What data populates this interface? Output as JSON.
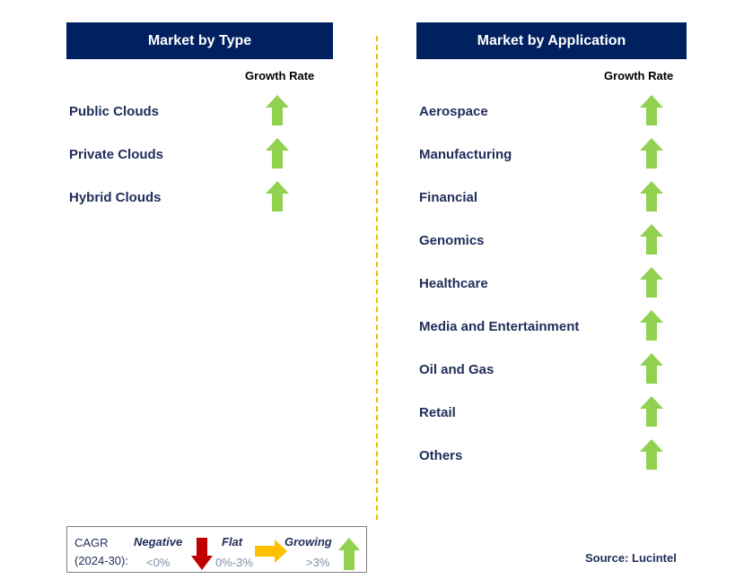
{
  "left": {
    "title": "Market by Type",
    "growth_label": "Growth Rate",
    "items": [
      {
        "label": "Public Clouds",
        "trend": "growing"
      },
      {
        "label": "Private Clouds",
        "trend": "growing"
      },
      {
        "label": "Hybrid Clouds",
        "trend": "growing"
      }
    ]
  },
  "right": {
    "title": "Market by Application",
    "growth_label": "Growth Rate",
    "items": [
      {
        "label": "Aerospace",
        "trend": "growing"
      },
      {
        "label": "Manufacturing",
        "trend": "growing"
      },
      {
        "label": "Financial",
        "trend": "growing"
      },
      {
        "label": "Genomics",
        "trend": "growing"
      },
      {
        "label": "Healthcare",
        "trend": "growing"
      },
      {
        "label": "Media and Entertainment",
        "trend": "growing"
      },
      {
        "label": "Oil and Gas",
        "trend": "growing"
      },
      {
        "label": "Retail",
        "trend": "growing"
      },
      {
        "label": "Others",
        "trend": "growing"
      }
    ]
  },
  "legend": {
    "cagr": "CAGR",
    "period": "(2024-30):",
    "negative": "Negative",
    "negative_range": "<0%",
    "flat": "Flat",
    "flat_range": "0%-3%",
    "growing": "Growing",
    "growing_range": ">3%"
  },
  "source": "Source: Lucintel",
  "colors": {
    "header": "#002060",
    "growing": "#92D050",
    "flat": "#FFC000",
    "negative": "#C00000",
    "divider": "#F5B800"
  }
}
